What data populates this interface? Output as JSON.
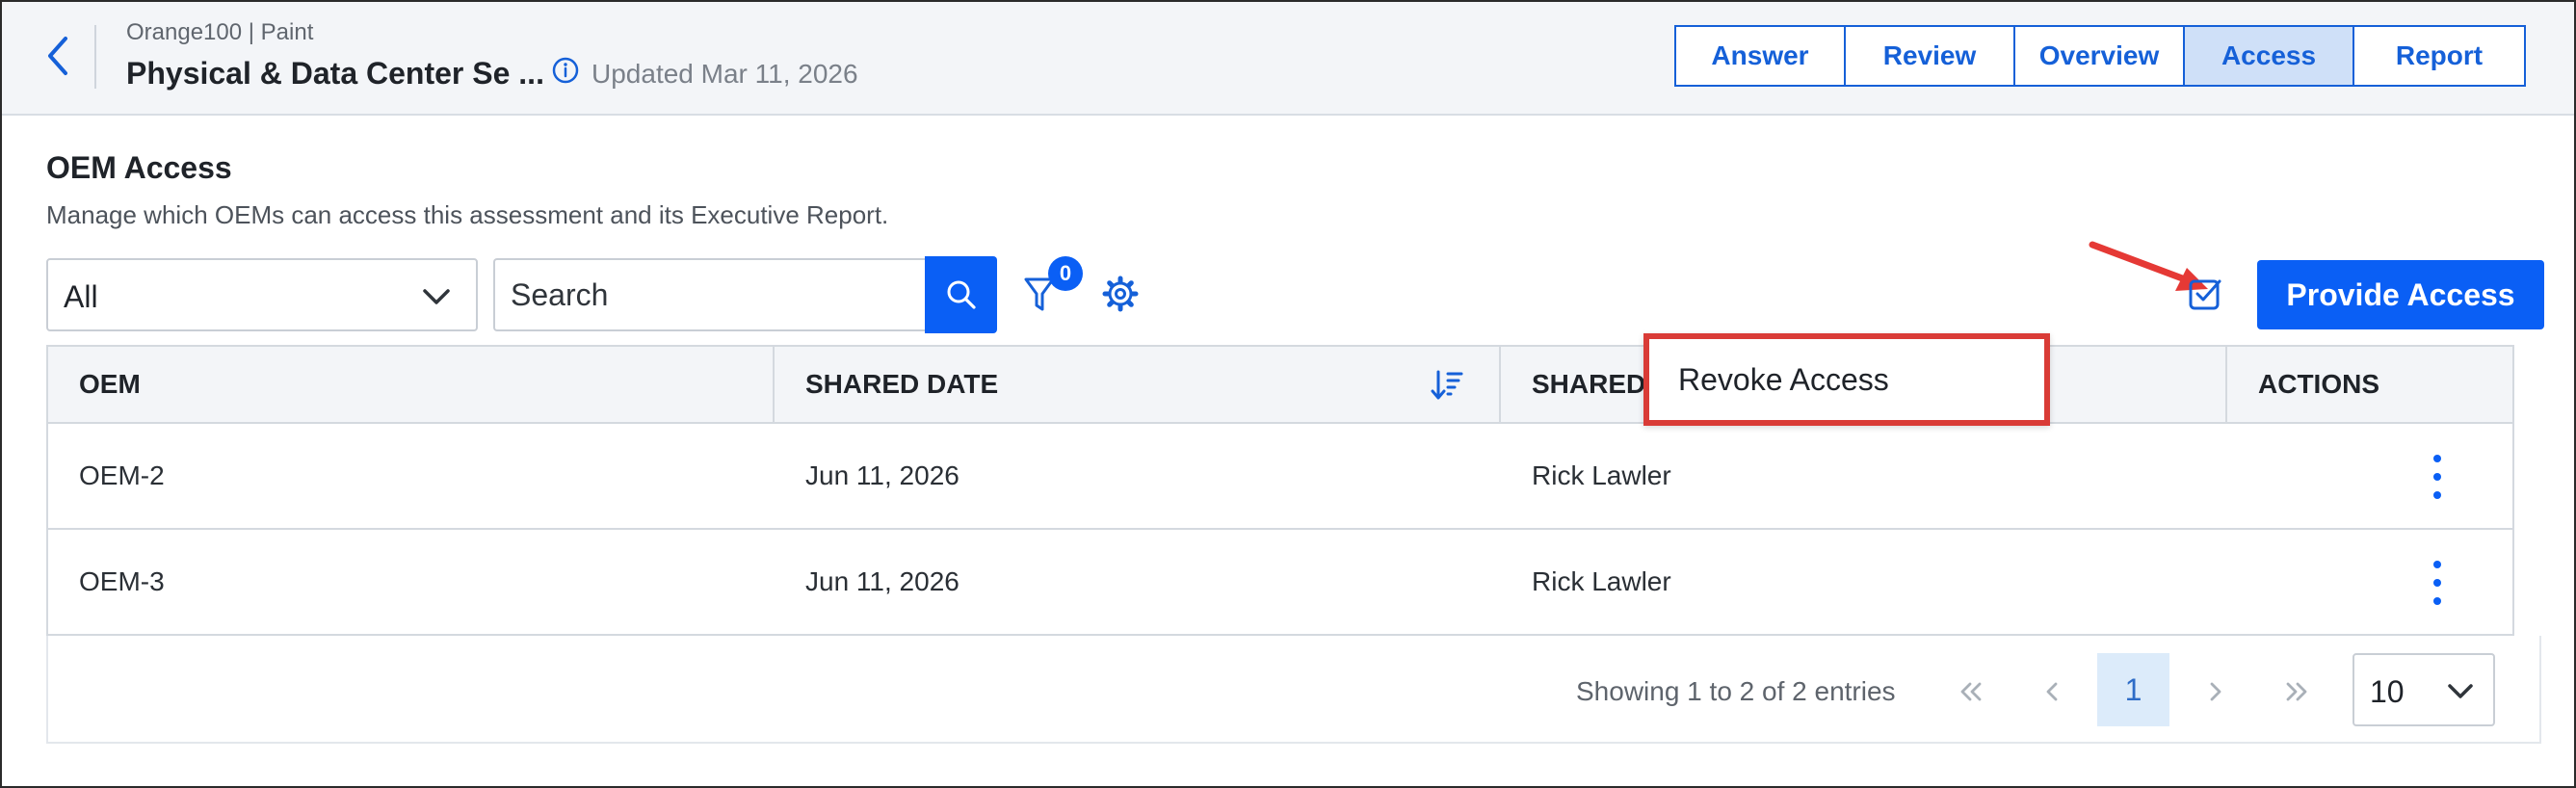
{
  "header": {
    "breadcrumb": "Orange100 | Paint",
    "title": "Physical & Data Center Se ...",
    "updated": "Updated Mar 11, 2026",
    "tabs": [
      {
        "label": "Answer"
      },
      {
        "label": "Review"
      },
      {
        "label": "Overview"
      },
      {
        "label": "Access",
        "active": true
      },
      {
        "label": "Report"
      }
    ]
  },
  "section": {
    "title": "OEM Access",
    "description": "Manage which OEMs can access this assessment and its Executive Report."
  },
  "toolbar": {
    "filter_select_value": "All",
    "search_placeholder": "Search",
    "filter_count": "0",
    "provide_access_label": "Provide Access"
  },
  "table": {
    "headers": {
      "oem": "OEM",
      "shared_date": "SHARED DATE",
      "shared_by": "SHARED",
      "actions": "ACTIONS"
    },
    "rows": [
      {
        "oem": "OEM-2",
        "shared_date": "Jun 11, 2026",
        "shared_by": "Rick Lawler"
      },
      {
        "oem": "OEM-3",
        "shared_date": "Jun 11, 2026",
        "shared_by": "Rick Lawler"
      }
    ]
  },
  "menu": {
    "items": [
      {
        "label": "Revoke Access"
      }
    ]
  },
  "pagination": {
    "summary": "Showing 1 to 2 of 2 entries",
    "current_page": "1",
    "page_size": "10"
  },
  "colors": {
    "accent": "#0a5ff5",
    "tab_active_bg": "#cfe0f8",
    "highlight_border": "#d93b36",
    "annotation_arrow": "#e53935"
  },
  "icons": {
    "back": "chevron-left-icon",
    "info": "info-icon",
    "search": "search-icon",
    "filter": "filter-icon",
    "settings": "gear-icon",
    "select_all": "checkbox-checked-icon",
    "sort": "sort-descending-icon",
    "row_actions": "kebab-menu-icon"
  }
}
